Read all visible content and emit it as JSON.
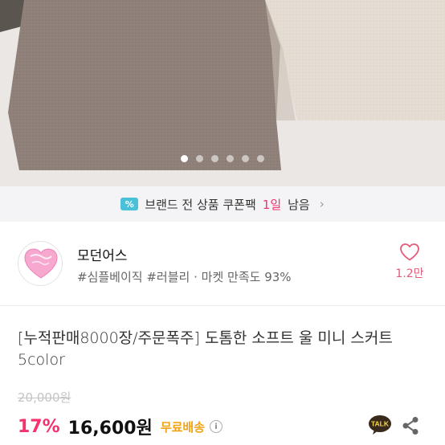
{
  "carousel": {
    "total": 6,
    "active_index": 0
  },
  "coupon_banner": {
    "icon": "ticket-percent-icon",
    "prefix": "브랜드 전 상품 쿠폰팩",
    "highlight": "1일",
    "suffix": "남음",
    "chevron": "›"
  },
  "shop": {
    "name": "모던어스",
    "tags": "#심플베이직 #러블리",
    "separator": "·",
    "satisfaction": "마켓 만족도 93%",
    "logo_icon": "heart-logo-icon"
  },
  "like": {
    "icon": "heart-outline-icon",
    "count": "1.2만"
  },
  "product": {
    "title": "[누적판매8000장/주문폭주] 도톰한 소프트 울 미니 스커트 5color",
    "original_price": "20,000원",
    "discount": "17%",
    "price": "16,600원",
    "shipping": "무료배송",
    "info_icon": "i"
  },
  "actions": {
    "talk_label": "TALK",
    "share_icon": "share-icon"
  },
  "colors": {
    "accent_pink": "#f5326e",
    "shipping_orange": "#f0a316",
    "coupon_icon": "#4bc0d9"
  }
}
